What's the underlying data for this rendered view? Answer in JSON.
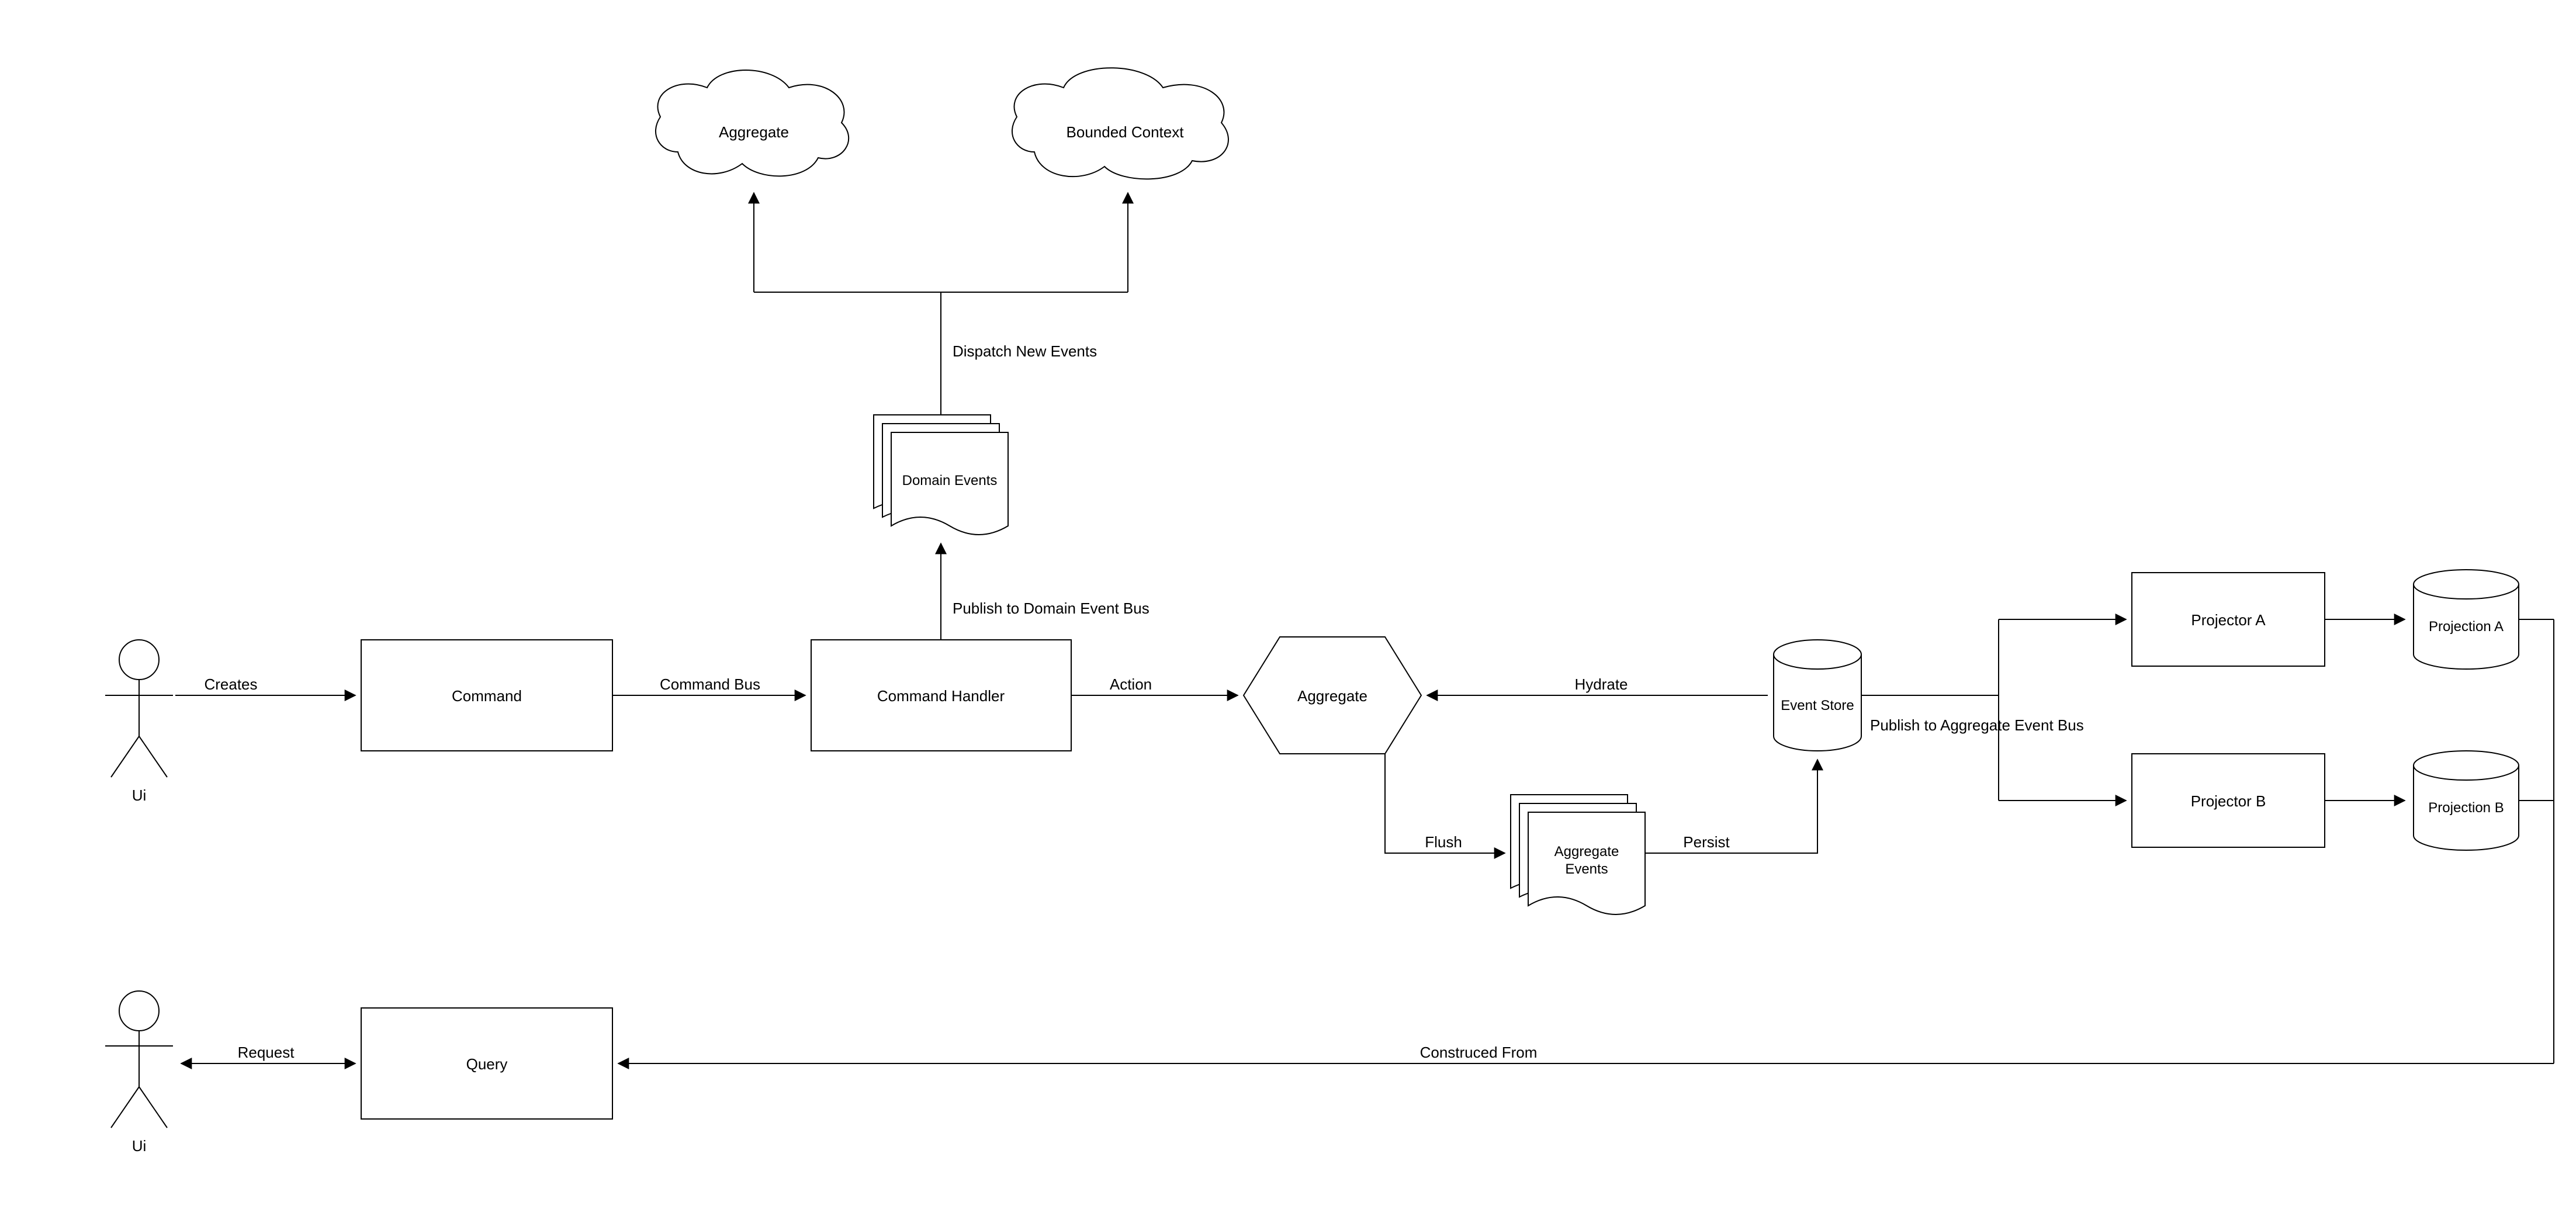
{
  "actors": {
    "ui1": "Ui",
    "ui2": "Ui"
  },
  "nodes": {
    "command": "Command",
    "commandHandler": "Command Handler",
    "aggregate": "Aggregate",
    "domainEvents": "Domain Events",
    "aggregateCloud": "Aggregate",
    "boundedContext": "Bounded Context",
    "aggregateEvents1": "Aggregate",
    "aggregateEvents2": "Events",
    "eventStore": "Event Store",
    "projectorA": "Projector A",
    "projectorB": "Projector B",
    "projectionA": "Projection A",
    "projectionB": "Projection B",
    "query": "Query"
  },
  "edges": {
    "creates": "Creates",
    "commandBus": "Command Bus",
    "action": "Action",
    "publishDomain": "Publish to Domain Event Bus",
    "dispatchNew": "Dispatch New Events",
    "hydrate": "Hydrate",
    "flush": "Flush",
    "persist": "Persist",
    "publishAggregate": "Publish to Aggregate Event Bus",
    "request": "Request",
    "constructedFrom": "Construced From"
  }
}
